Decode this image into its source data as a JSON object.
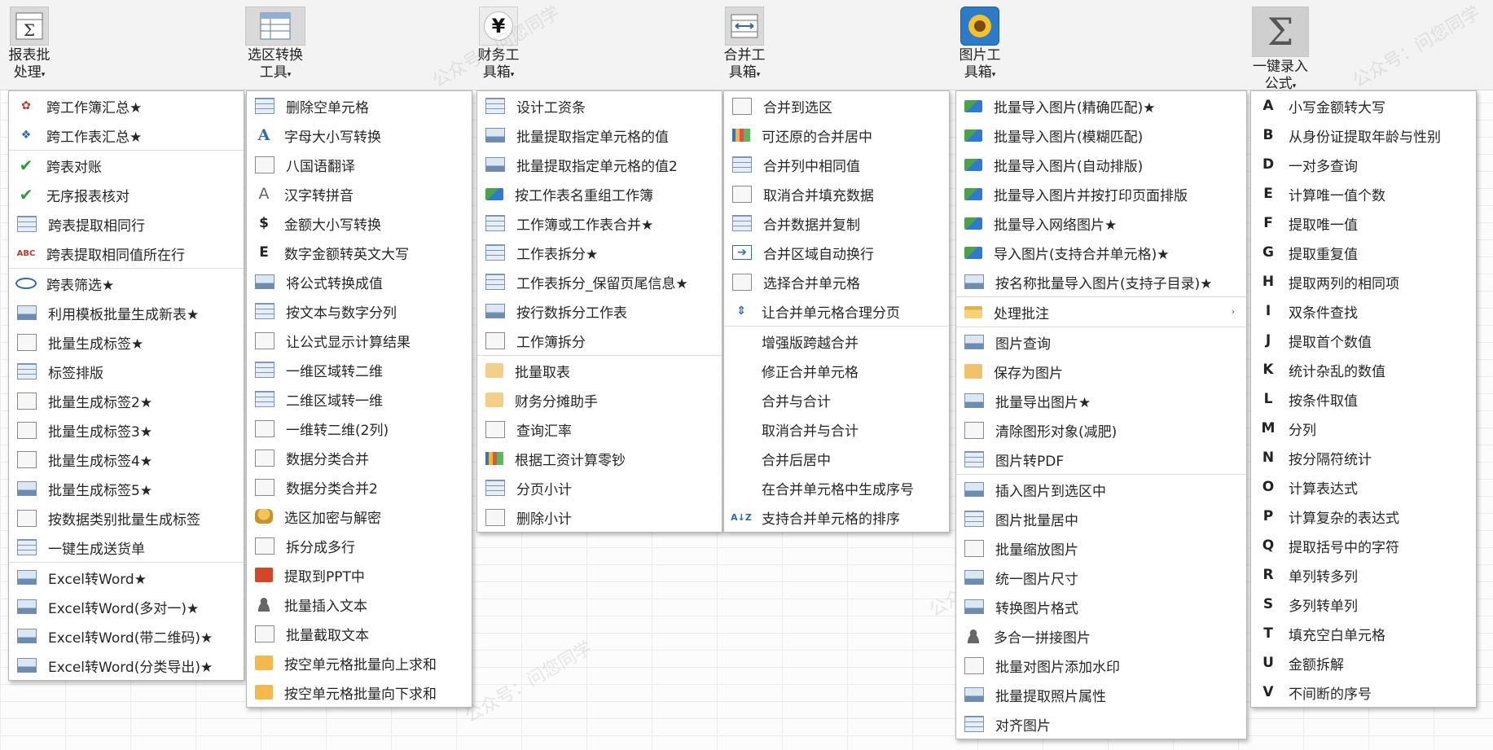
{
  "ribbon": {
    "buttons": [
      {
        "label": "报表批\n处理",
        "icon": "sigma-table-icon"
      },
      {
        "label": "选区转换\n工具",
        "icon": "table-convert-icon"
      },
      {
        "label": "财务工\n具箱",
        "icon": "yen-icon",
        "glyph": "¥"
      },
      {
        "label": "合并工\n具箱",
        "icon": "merge-cells-icon"
      },
      {
        "label": "图片工\n具箱",
        "icon": "sunflower-picture-icon"
      },
      {
        "label": "一键录入\n公式",
        "icon": "sigma-icon",
        "glyph": "Σ"
      }
    ],
    "dropdown_caret": "▾"
  },
  "watermark": "公众号：问您同学",
  "menus": {
    "report": {
      "items": [
        {
          "label": "跨工作簿汇总★",
          "icon": "brain-icon"
        },
        {
          "label": "跨工作表汇总★",
          "icon": "blue-leaf-icon"
        },
        {
          "label": "跨表对账",
          "icon": "checkmark-icon",
          "sep": true
        },
        {
          "label": "无序报表核对",
          "icon": "checkmark-icon"
        },
        {
          "label": "跨表提取相同行",
          "icon": "table-icon"
        },
        {
          "label": "跨表提取相同值所在行",
          "icon": "abc-icon"
        },
        {
          "label": "跨表筛选★",
          "icon": "search-icon",
          "sep": true
        },
        {
          "label": "利用模板批量生成新表★",
          "icon": "template-icon"
        },
        {
          "label": "批量生成标签★",
          "icon": "label-icon"
        },
        {
          "label": "标签排版",
          "icon": "label-layout-icon"
        },
        {
          "label": "批量生成标签2★",
          "icon": "label-icon"
        },
        {
          "label": "批量生成标签3★",
          "icon": "label-icon"
        },
        {
          "label": "批量生成标签4★",
          "icon": "label-icon"
        },
        {
          "label": "批量生成标签5★",
          "icon": "label-person-icon"
        },
        {
          "label": "按数据类别批量生成标签",
          "icon": "category-label-icon"
        },
        {
          "label": "一键生成送货单",
          "icon": "delivery-note-icon"
        },
        {
          "label": "Excel转Word★",
          "icon": "excel-word-icon",
          "sep": true
        },
        {
          "label": "Excel转Word(多对一)★",
          "icon": "excel-word-icon"
        },
        {
          "label": "Excel转Word(带二维码)★",
          "icon": "excel-word-icon"
        },
        {
          "label": "Excel转Word(分类导出)★",
          "icon": "excel-word-icon"
        }
      ]
    },
    "selection": {
      "items": [
        {
          "label": "删除空单元格",
          "icon": "grid-icon"
        },
        {
          "label": "字母大小写转换",
          "icon": "font-a-icon"
        },
        {
          "label": "八国语翻译",
          "icon": "translate-icon"
        },
        {
          "label": "汉字转拼音",
          "icon": "outline-a-icon"
        },
        {
          "label": "金额大小写转换",
          "icon": "dollar-icon"
        },
        {
          "label": "数字金额转英文大写",
          "icon": "letter-e-icon"
        },
        {
          "label": "将公式转换成值",
          "icon": "formula-value-icon"
        },
        {
          "label": "按文本与数字分列",
          "icon": "split-columns-icon"
        },
        {
          "label": "让公式显示计算结果",
          "icon": "formula-result-icon"
        },
        {
          "label": "一维区域转二维",
          "icon": "range-convert-icon"
        },
        {
          "label": "二维区域转一维",
          "icon": "range-convert-icon"
        },
        {
          "label": "一维转二维(2列)",
          "icon": "column-icon"
        },
        {
          "label": "数据分类合并",
          "icon": "column-icon"
        },
        {
          "label": "数据分类合并2",
          "icon": "column-icon"
        },
        {
          "label": "选区加密与解密",
          "icon": "lock-icon"
        },
        {
          "label": "拆分成多行",
          "icon": "split-rows-icon"
        },
        {
          "label": "提取到PPT中",
          "icon": "ppt-icon"
        },
        {
          "label": "批量插入文本",
          "icon": "user-add-icon"
        },
        {
          "label": "批量截取文本",
          "icon": "text-field-icon"
        },
        {
          "label": "按空单元格批量向上求和",
          "icon": "sum-up-icon"
        },
        {
          "label": "按空单元格批量向下求和",
          "icon": "sum-down-icon"
        }
      ]
    },
    "finance": {
      "items": [
        {
          "label": "设计工资条",
          "icon": "payslip-icon"
        },
        {
          "label": "批量提取指定单元格的值",
          "icon": "extract-cell-icon"
        },
        {
          "label": "批量提取指定单元格的值2",
          "icon": "extract-cell-icon"
        },
        {
          "label": "按工作表名重组工作簿",
          "icon": "excel-icon"
        },
        {
          "label": "工作簿或工作表合并★",
          "icon": "merge-sheets-icon"
        },
        {
          "label": "工作表拆分★",
          "icon": "split-sheet-icon"
        },
        {
          "label": "工作表拆分_保留页尾信息★",
          "icon": "split-sheet-icon"
        },
        {
          "label": "按行数拆分工作表",
          "icon": "split-rows-sheet-icon"
        },
        {
          "label": "工作簿拆分",
          "icon": "split-book-icon"
        },
        {
          "label": "批量取表",
          "icon": "fetch-table-icon",
          "sep": true
        },
        {
          "label": "财务分摊助手",
          "icon": "allocation-icon"
        },
        {
          "label": "查询汇率",
          "icon": "exchange-rate-icon"
        },
        {
          "label": "根据工资计算零钞",
          "icon": "color-blocks-icon"
        },
        {
          "label": "分页小计",
          "icon": "subtotal-icon"
        },
        {
          "label": "删除小计",
          "icon": "delete-subtotal-icon"
        }
      ]
    },
    "merge": {
      "items": [
        {
          "label": "合并到选区",
          "icon": "merge-to-selection-icon"
        },
        {
          "label": "可还原的合并居中",
          "icon": "bar-chart-icon"
        },
        {
          "label": "合并列中相同值",
          "icon": "table-icon"
        },
        {
          "label": "取消合并填充数据",
          "icon": "unmerge-fill-icon"
        },
        {
          "label": "合并数据并复制",
          "icon": "merge-copy-icon"
        },
        {
          "label": "合并区域自动换行",
          "icon": "wrap-arrow-icon"
        },
        {
          "label": "选择合并单元格",
          "icon": "select-merged-icon"
        },
        {
          "label": "让合并单元格合理分页",
          "icon": "page-break-icon"
        },
        {
          "label": "增强版跨越合并",
          "icon": "",
          "sep": true
        },
        {
          "label": "修正合并单元格",
          "icon": ""
        },
        {
          "label": "合并与合计",
          "icon": ""
        },
        {
          "label": "取消合并与合计",
          "icon": ""
        },
        {
          "label": "合并后居中",
          "icon": ""
        },
        {
          "label": "在合并单元格中生成序号",
          "icon": ""
        },
        {
          "label": "支持合并单元格的排序",
          "icon": "sort-az-icon"
        }
      ]
    },
    "picture": {
      "items": [
        {
          "label": "批量导入图片(精确匹配)★",
          "icon": "import-picture-icon"
        },
        {
          "label": "批量导入图片(模糊匹配)",
          "icon": "import-picture-icon"
        },
        {
          "label": "批量导入图片(自动排版)",
          "icon": "import-picture-icon"
        },
        {
          "label": "批量导入图片并按打印页面排版",
          "icon": "import-picture-icon"
        },
        {
          "label": "批量导入网络图片★",
          "icon": "import-picture-icon"
        },
        {
          "label": "导入图片(支持合并单元格)★",
          "icon": "import-picture-icon"
        },
        {
          "label": "按名称批量导入图片(支持子目录)★",
          "icon": "import-by-name-icon"
        },
        {
          "label": "处理批注",
          "icon": "folder-icon",
          "sep": true,
          "submenu": true
        },
        {
          "label": "图片查询",
          "icon": "picture-search-icon",
          "sep": true
        },
        {
          "label": "保存为图片",
          "icon": "save-picture-icon"
        },
        {
          "label": "批量导出图片★",
          "icon": "export-picture-icon"
        },
        {
          "label": "清除图形对象(减肥)",
          "icon": "clear-shapes-icon"
        },
        {
          "label": "图片转PDF",
          "icon": "pdf-icon"
        },
        {
          "label": "插入图片到选区中",
          "icon": "insert-picture-icon",
          "sep": true
        },
        {
          "label": "图片批量居中",
          "icon": "center-picture-icon"
        },
        {
          "label": "批量缩放图片",
          "icon": "scale-picture-icon"
        },
        {
          "label": "统一图片尺寸",
          "icon": "resize-picture-icon"
        },
        {
          "label": "转换图片格式",
          "icon": "convert-format-icon"
        },
        {
          "label": "多合一拼接图片",
          "icon": "users-icon"
        },
        {
          "label": "批量对图片添加水印",
          "icon": "watermark-icon"
        },
        {
          "label": "批量提取照片属性",
          "icon": "photo-properties-icon"
        },
        {
          "label": "对齐图片",
          "icon": "align-picture-icon"
        }
      ],
      "submenu_arrow": "›"
    },
    "formula": {
      "items": [
        {
          "key": "A",
          "label": "小写金额转大写"
        },
        {
          "key": "B",
          "label": "从身份证提取年龄与性别"
        },
        {
          "key": "D",
          "label": "一对多查询"
        },
        {
          "key": "E",
          "label": "计算唯一值个数"
        },
        {
          "key": "F",
          "label": "提取唯一值"
        },
        {
          "key": "G",
          "label": "提取重复值"
        },
        {
          "key": "H",
          "label": "提取两列的相同项"
        },
        {
          "key": "I",
          "label": "双条件查找"
        },
        {
          "key": "J",
          "label": "提取首个数值"
        },
        {
          "key": "K",
          "label": "统计杂乱的数值"
        },
        {
          "key": "L",
          "label": "按条件取值"
        },
        {
          "key": "M",
          "label": "分列"
        },
        {
          "key": "N",
          "label": "按分隔符统计"
        },
        {
          "key": "O",
          "label": "计算表达式"
        },
        {
          "key": "P",
          "label": "计算复杂的表达式"
        },
        {
          "key": "Q",
          "label": "提取括号中的字符"
        },
        {
          "key": "R",
          "label": "单列转多列"
        },
        {
          "key": "S",
          "label": "多列转单列"
        },
        {
          "key": "T",
          "label": "填充空白单元格"
        },
        {
          "key": "U",
          "label": "金额拆解"
        },
        {
          "key": "V",
          "label": "不间断的序号"
        }
      ]
    }
  }
}
